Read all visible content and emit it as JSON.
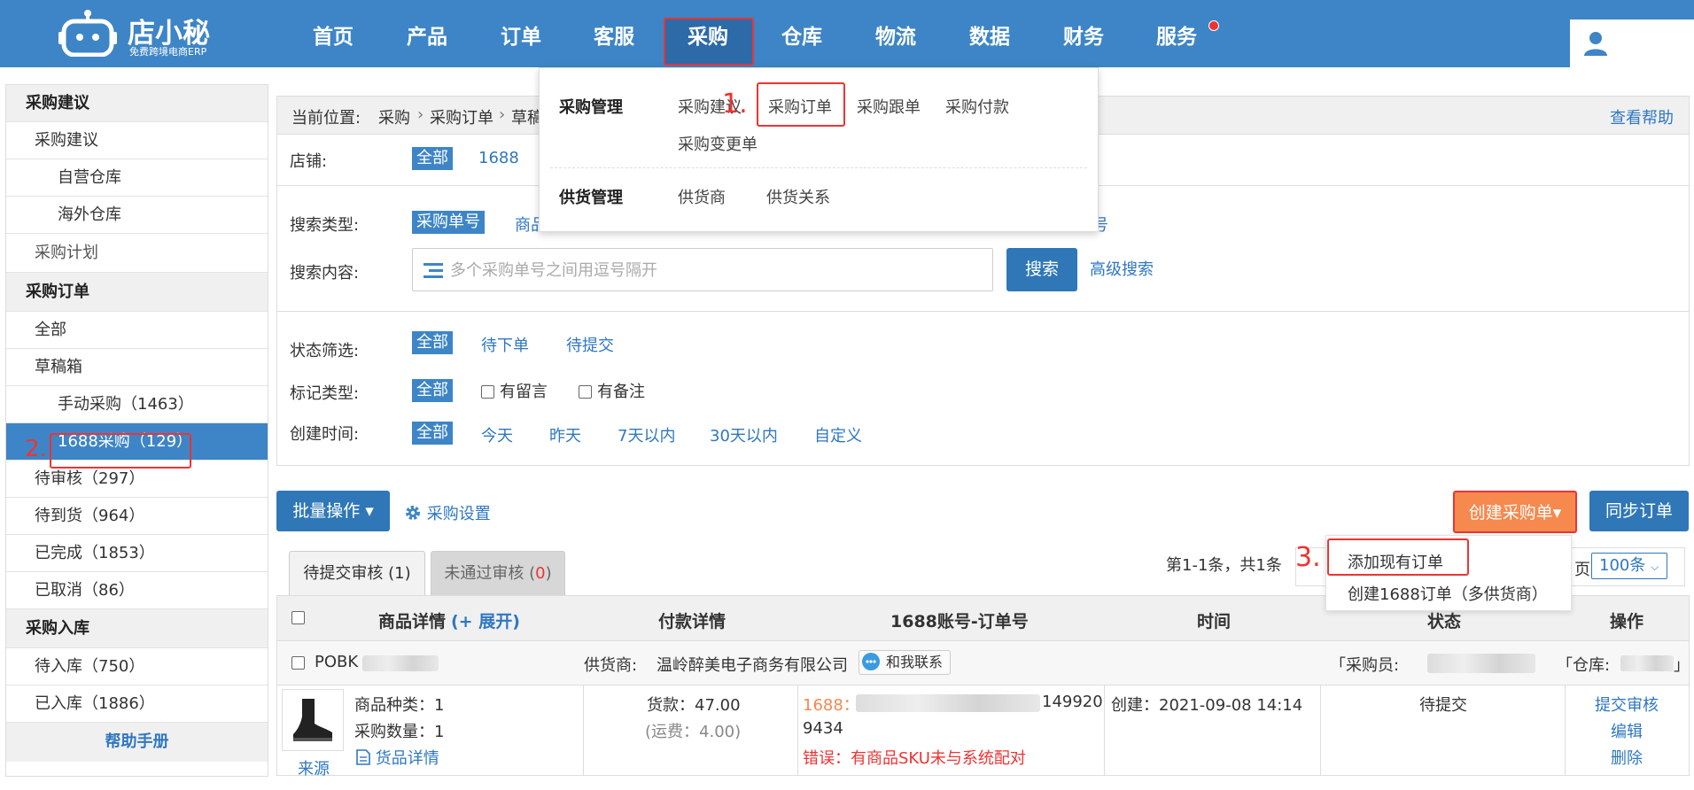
{
  "brand": {
    "name": "店小秘",
    "tagline": "免费跨境电商ERP"
  },
  "nav": {
    "items": [
      "首页",
      "产品",
      "订单",
      "客服",
      "采购",
      "仓库",
      "物流",
      "数据",
      "财务",
      "服务"
    ]
  },
  "purchase_menu": {
    "group1": "采购管理",
    "group1_items": [
      "采购建议",
      "采购订单",
      "采购跟单",
      "采购付款",
      "采购变更单"
    ],
    "group2": "供货管理",
    "group2_items": [
      "供货商",
      "供货关系"
    ]
  },
  "steps": {
    "s1": "1.",
    "s2": "2.",
    "s3": "3."
  },
  "sidebar": {
    "sec1": "采购建议",
    "sec1_items": [
      "采购建议",
      "自营仓库",
      "海外仓库",
      "采购计划"
    ],
    "sec2": "采购订单",
    "sec2_items": [
      "全部",
      "草稿箱",
      "手动采购（1463）",
      "1688采购（129）",
      "待审核（297）",
      "待到货（964）",
      "已完成（1853）",
      "已取消（86）"
    ],
    "sec3": "采购入库",
    "sec3_items": [
      "待入库（750）",
      "已入库（1886）"
    ],
    "help": "帮助手册"
  },
  "breadcrumb": {
    "prefix": "当前位置:",
    "path1": "采购",
    "path2": "采购订单",
    "path3": "草稿",
    "help": "查看帮助"
  },
  "filters": {
    "shop_label": "店铺:",
    "shop_all": "全部",
    "shop_1688": "1688",
    "search_type_label": "搜索类型:",
    "search_type_active": "采购单号",
    "search_type_next": "商品",
    "search_type_tail": "号",
    "search_content_label": "搜索内容:",
    "search_placeholder": "多个采购单号之间用逗号隔开",
    "search_btn": "搜索",
    "advanced": "高级搜索",
    "status_label": "状态筛选:",
    "status_all": "全部",
    "status_opts": [
      "待下单",
      "待提交"
    ],
    "mark_label": "标记类型:",
    "mark_all": "全部",
    "mark_opts": [
      "有留言",
      "有备注"
    ],
    "time_label": "创建时间:",
    "time_all": "全部",
    "time_opts": [
      "今天",
      "昨天",
      "7天以内",
      "30天以内",
      "自定义"
    ]
  },
  "actions": {
    "batch": "批量操作 ▾",
    "settings": "采购设置",
    "create": "创建采购单▾",
    "sync": "同步订单",
    "create_menu": [
      "添加现有订单",
      "创建1688订单（多供货商）"
    ]
  },
  "tabs": {
    "t1": "待提交审核 (1)",
    "t2_prefix": "未通过审核 (",
    "t2_count": "0",
    "t2_suffix": ")"
  },
  "pager": {
    "info": "第1-1条，共1条",
    "page_hint": "页",
    "size": "100条"
  },
  "table": {
    "headers": [
      "商品详情",
      "(+ 展开)",
      "付款详情",
      "1688账号-订单号",
      "时间",
      "状态",
      "操作"
    ],
    "order": {
      "id_prefix": "POBK",
      "supplier_label": "供货商:",
      "supplier": "温岭醉美电子商务有限公司",
      "contact": "和我联系",
      "buyer_label": "「采购员:",
      "warehouse_label": "「仓库:",
      "warehouse_end": "」",
      "kinds": "商品种类：1",
      "qty": "采购数量：1",
      "goods_detail": "货品详情",
      "source": "来源",
      "payment": "货款：47.00",
      "freight": "(运费：4.00)",
      "acct_prefix": "1688：",
      "order_no_tail": "149920",
      "order_no_line2": "9434",
      "error": "错误：有商品SKU未与系统配对",
      "created": "创建：2021-09-08 14:14",
      "status": "待提交",
      "ops": [
        "提交审核",
        "编辑",
        "删除"
      ]
    }
  },
  "colors": {
    "primary": "#3d85c6",
    "highlight": "#ee3333",
    "orange": "#f5894e",
    "link": "#2f77c0"
  }
}
